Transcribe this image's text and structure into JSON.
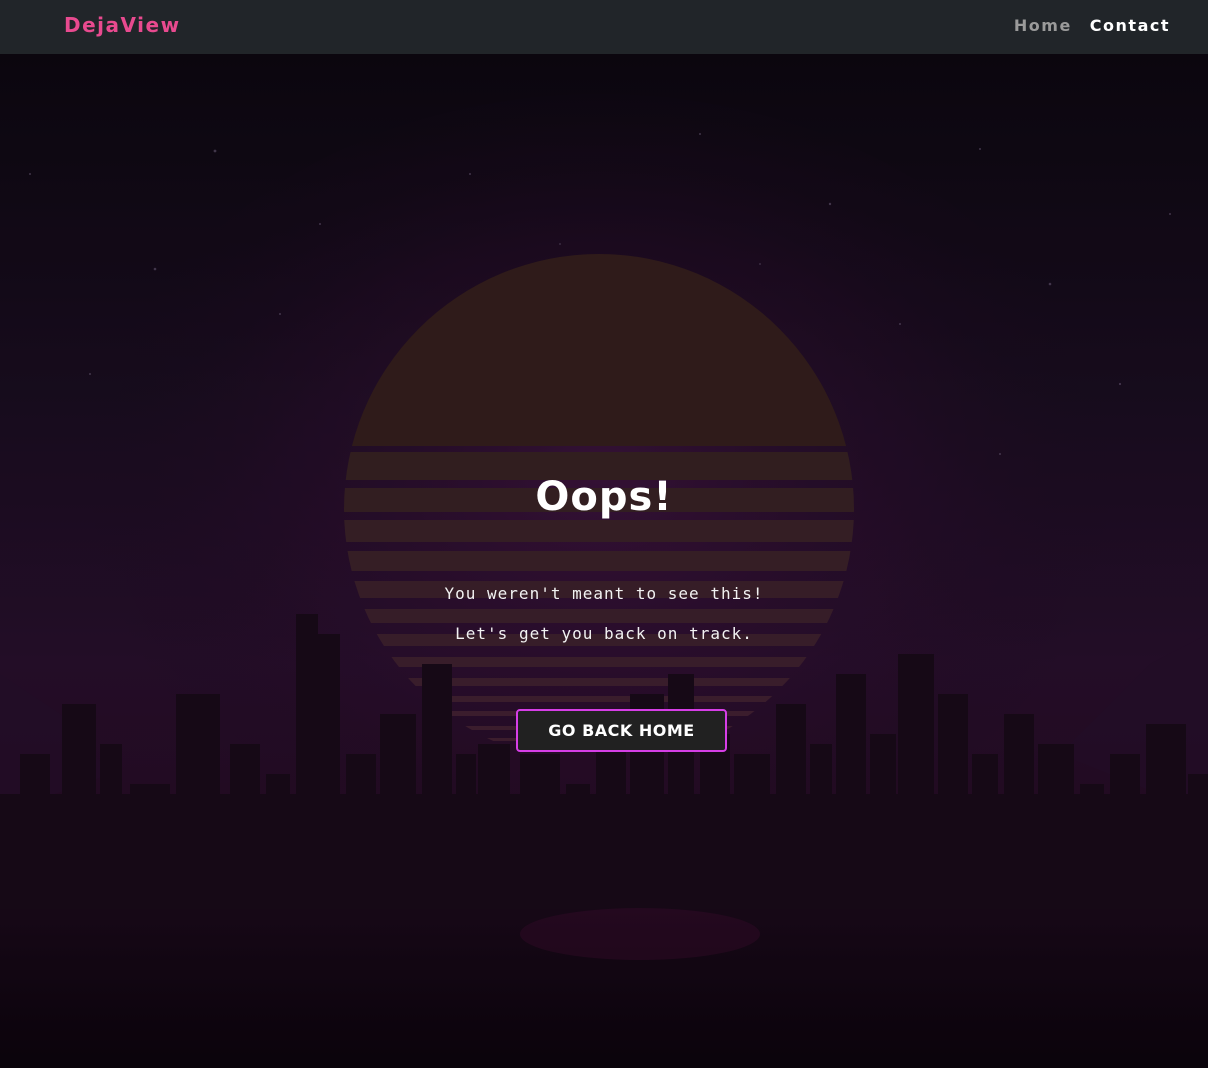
{
  "navbar": {
    "brand": "DejaView",
    "links": [
      {
        "label": "Home",
        "active": false
      },
      {
        "label": "Contact",
        "active": true
      }
    ]
  },
  "main": {
    "title": "Oops!",
    "messages": [
      "You weren't meant to see this!",
      "Let's get you back on track."
    ],
    "button_label": "GO BACK HOME"
  },
  "colors": {
    "navbar_bg": "#212529",
    "brand": "#e84a8f",
    "link_inactive": "#9a9a9a",
    "link_active": "#ffffff",
    "button_border": "#d63ee6",
    "button_bg": "#212121",
    "sun": "#3a2220",
    "background": "#1a0b1e"
  }
}
